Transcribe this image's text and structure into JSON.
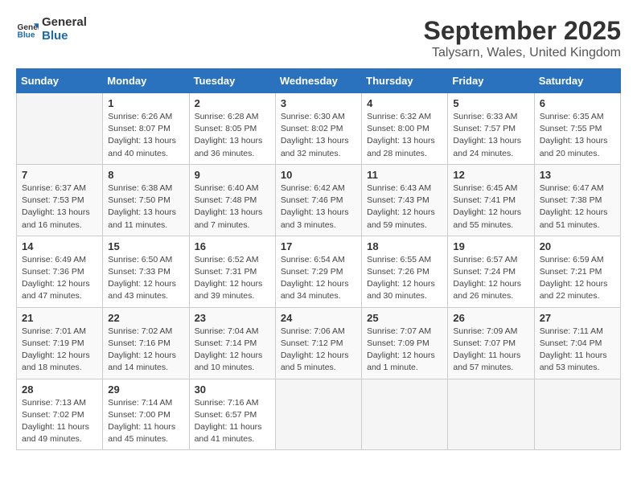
{
  "header": {
    "logo_line1": "General",
    "logo_line2": "Blue",
    "month": "September 2025",
    "location": "Talysarn, Wales, United Kingdom"
  },
  "weekdays": [
    "Sunday",
    "Monday",
    "Tuesday",
    "Wednesday",
    "Thursday",
    "Friday",
    "Saturday"
  ],
  "weeks": [
    [
      {
        "day": "",
        "info": ""
      },
      {
        "day": "1",
        "info": "Sunrise: 6:26 AM\nSunset: 8:07 PM\nDaylight: 13 hours\nand 40 minutes."
      },
      {
        "day": "2",
        "info": "Sunrise: 6:28 AM\nSunset: 8:05 PM\nDaylight: 13 hours\nand 36 minutes."
      },
      {
        "day": "3",
        "info": "Sunrise: 6:30 AM\nSunset: 8:02 PM\nDaylight: 13 hours\nand 32 minutes."
      },
      {
        "day": "4",
        "info": "Sunrise: 6:32 AM\nSunset: 8:00 PM\nDaylight: 13 hours\nand 28 minutes."
      },
      {
        "day": "5",
        "info": "Sunrise: 6:33 AM\nSunset: 7:57 PM\nDaylight: 13 hours\nand 24 minutes."
      },
      {
        "day": "6",
        "info": "Sunrise: 6:35 AM\nSunset: 7:55 PM\nDaylight: 13 hours\nand 20 minutes."
      }
    ],
    [
      {
        "day": "7",
        "info": "Sunrise: 6:37 AM\nSunset: 7:53 PM\nDaylight: 13 hours\nand 16 minutes."
      },
      {
        "day": "8",
        "info": "Sunrise: 6:38 AM\nSunset: 7:50 PM\nDaylight: 13 hours\nand 11 minutes."
      },
      {
        "day": "9",
        "info": "Sunrise: 6:40 AM\nSunset: 7:48 PM\nDaylight: 13 hours\nand 7 minutes."
      },
      {
        "day": "10",
        "info": "Sunrise: 6:42 AM\nSunset: 7:46 PM\nDaylight: 13 hours\nand 3 minutes."
      },
      {
        "day": "11",
        "info": "Sunrise: 6:43 AM\nSunset: 7:43 PM\nDaylight: 12 hours\nand 59 minutes."
      },
      {
        "day": "12",
        "info": "Sunrise: 6:45 AM\nSunset: 7:41 PM\nDaylight: 12 hours\nand 55 minutes."
      },
      {
        "day": "13",
        "info": "Sunrise: 6:47 AM\nSunset: 7:38 PM\nDaylight: 12 hours\nand 51 minutes."
      }
    ],
    [
      {
        "day": "14",
        "info": "Sunrise: 6:49 AM\nSunset: 7:36 PM\nDaylight: 12 hours\nand 47 minutes."
      },
      {
        "day": "15",
        "info": "Sunrise: 6:50 AM\nSunset: 7:33 PM\nDaylight: 12 hours\nand 43 minutes."
      },
      {
        "day": "16",
        "info": "Sunrise: 6:52 AM\nSunset: 7:31 PM\nDaylight: 12 hours\nand 39 minutes."
      },
      {
        "day": "17",
        "info": "Sunrise: 6:54 AM\nSunset: 7:29 PM\nDaylight: 12 hours\nand 34 minutes."
      },
      {
        "day": "18",
        "info": "Sunrise: 6:55 AM\nSunset: 7:26 PM\nDaylight: 12 hours\nand 30 minutes."
      },
      {
        "day": "19",
        "info": "Sunrise: 6:57 AM\nSunset: 7:24 PM\nDaylight: 12 hours\nand 26 minutes."
      },
      {
        "day": "20",
        "info": "Sunrise: 6:59 AM\nSunset: 7:21 PM\nDaylight: 12 hours\nand 22 minutes."
      }
    ],
    [
      {
        "day": "21",
        "info": "Sunrise: 7:01 AM\nSunset: 7:19 PM\nDaylight: 12 hours\nand 18 minutes."
      },
      {
        "day": "22",
        "info": "Sunrise: 7:02 AM\nSunset: 7:16 PM\nDaylight: 12 hours\nand 14 minutes."
      },
      {
        "day": "23",
        "info": "Sunrise: 7:04 AM\nSunset: 7:14 PM\nDaylight: 12 hours\nand 10 minutes."
      },
      {
        "day": "24",
        "info": "Sunrise: 7:06 AM\nSunset: 7:12 PM\nDaylight: 12 hours\nand 5 minutes."
      },
      {
        "day": "25",
        "info": "Sunrise: 7:07 AM\nSunset: 7:09 PM\nDaylight: 12 hours\nand 1 minute."
      },
      {
        "day": "26",
        "info": "Sunrise: 7:09 AM\nSunset: 7:07 PM\nDaylight: 11 hours\nand 57 minutes."
      },
      {
        "day": "27",
        "info": "Sunrise: 7:11 AM\nSunset: 7:04 PM\nDaylight: 11 hours\nand 53 minutes."
      }
    ],
    [
      {
        "day": "28",
        "info": "Sunrise: 7:13 AM\nSunset: 7:02 PM\nDaylight: 11 hours\nand 49 minutes."
      },
      {
        "day": "29",
        "info": "Sunrise: 7:14 AM\nSunset: 7:00 PM\nDaylight: 11 hours\nand 45 minutes."
      },
      {
        "day": "30",
        "info": "Sunrise: 7:16 AM\nSunset: 6:57 PM\nDaylight: 11 hours\nand 41 minutes."
      },
      {
        "day": "",
        "info": ""
      },
      {
        "day": "",
        "info": ""
      },
      {
        "day": "",
        "info": ""
      },
      {
        "day": "",
        "info": ""
      }
    ]
  ]
}
